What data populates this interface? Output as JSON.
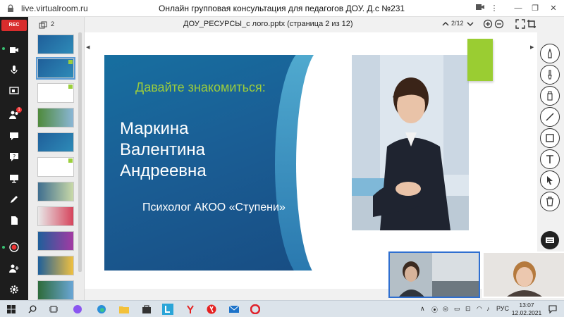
{
  "browser": {
    "url": "live.virtualroom.ru",
    "window_title": "Онлайн групповая консультация для педагогов ДОУ. Д.с №231"
  },
  "sidebar": {
    "rec_label": "REC",
    "participants_badge": "1"
  },
  "thumbnails": {
    "count_label": "2"
  },
  "toolbar": {
    "document_title": "ДОУ_РЕСУРСЫ_с лого.pptx (страница 2 из 12)",
    "page_indicator": "2/12"
  },
  "slide": {
    "greeting": "Давайте знакомиться:",
    "name_line1": "Маркина",
    "name_line2": "Валентина",
    "name_line3": "Андреевна",
    "role": "Психолог АКОО «Ступени»"
  },
  "taskbar": {
    "language": "РУС",
    "time": "13:07",
    "date": "12.02.2021"
  },
  "colors": {
    "slide_blue": "#1a5e95",
    "accent_green": "#9acd32",
    "rec_red": "#d92d2d",
    "active_video_border": "#2f6fd0"
  }
}
